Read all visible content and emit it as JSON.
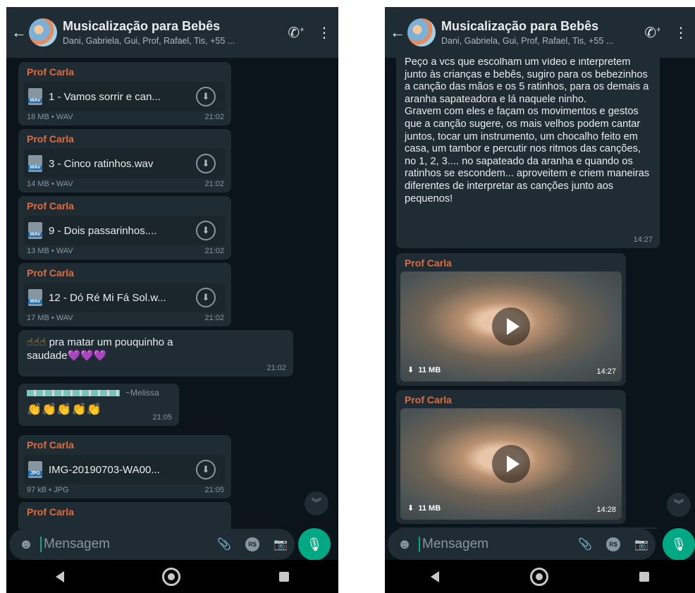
{
  "colors": {
    "header": "#1f2c34",
    "chat_bg": "#0b141a",
    "bubble": "#202c33",
    "sender": "#e26b3c",
    "accent": "#00a884"
  },
  "header": {
    "title": "Musicalização para Bebês",
    "subtitle_left": "Dani, Gabriela, Gui, Prof, Rafael, Tis, +55 ...",
    "subtitle_right": "Dani, Gabriela, Gui, Prof, Rafael, Tis, +55 ...",
    "back_icon": "arrow-left-icon",
    "call_icon": "add-call-icon",
    "menu_icon": "more-vertical-icon"
  },
  "left_messages": [
    {
      "sender": "Prof Carla",
      "type": "WAV",
      "file": "1 - Vamos sorrir e can...",
      "meta": "18 MB • WAV",
      "time": "21:02"
    },
    {
      "sender": "Prof Carla",
      "type": "WAV",
      "file": "3 - Cinco ratinhos.wav",
      "meta": "14 MB • WAV",
      "time": "21:02"
    },
    {
      "sender": "Prof Carla",
      "type": "WAV",
      "file": "9 - Dois passarinhos....",
      "meta": "13 MB • WAV",
      "time": "21:02"
    },
    {
      "sender": "Prof Carla",
      "type": "WAV",
      "file": "12 - Dó Ré Mi Fá Sol.w...",
      "meta": "17 MB • WAV",
      "time": "21:02"
    }
  ],
  "emoji_message": {
    "emojis": "☝☝☝",
    "line1": " pra matar um pouquinho a",
    "line2": "saudade",
    "hearts": "💜💜💜",
    "time": "21:02"
  },
  "melissa_message": {
    "name": "~Melissa",
    "claps": "👏👏👏👏👏",
    "time": "21:05"
  },
  "jpg_message": {
    "sender": "Prof Carla",
    "type": "JPG",
    "file": "IMG-20190703-WA00...",
    "meta": "97 kB • JPG",
    "time": "21:05"
  },
  "partial_sender": "Prof Carla",
  "right_text_message": {
    "text": "Peço a vcs que escolham um vídeo e interpretem junto às crianças e bebês, sugiro para os bebezinhos a canção das mãos e os 5 ratinhos, para os demais a aranha sapateadora e lá naquele ninho.\nGravem com eles e façam os movimentos e gestos que a canção sugere, os mais velhos podem cantar juntos, tocar um instrumento, um chocalho feito em casa, um tambor e percutir nos ritmos das canções, no 1, 2, 3.... no sapateado da aranha e quando os ratinhos se escondem... aproveitem e criem maneiras diferentes de interpretar as canções junto aos pequenos!",
    "time": "14:27"
  },
  "right_videos": [
    {
      "sender": "Prof Carla",
      "size": "11 MB",
      "time": "14:27"
    },
    {
      "sender": "Prof Carla",
      "size": "11 MB",
      "time": "14:28"
    }
  ],
  "input": {
    "placeholder": "Mensagem",
    "currency": "R$"
  }
}
